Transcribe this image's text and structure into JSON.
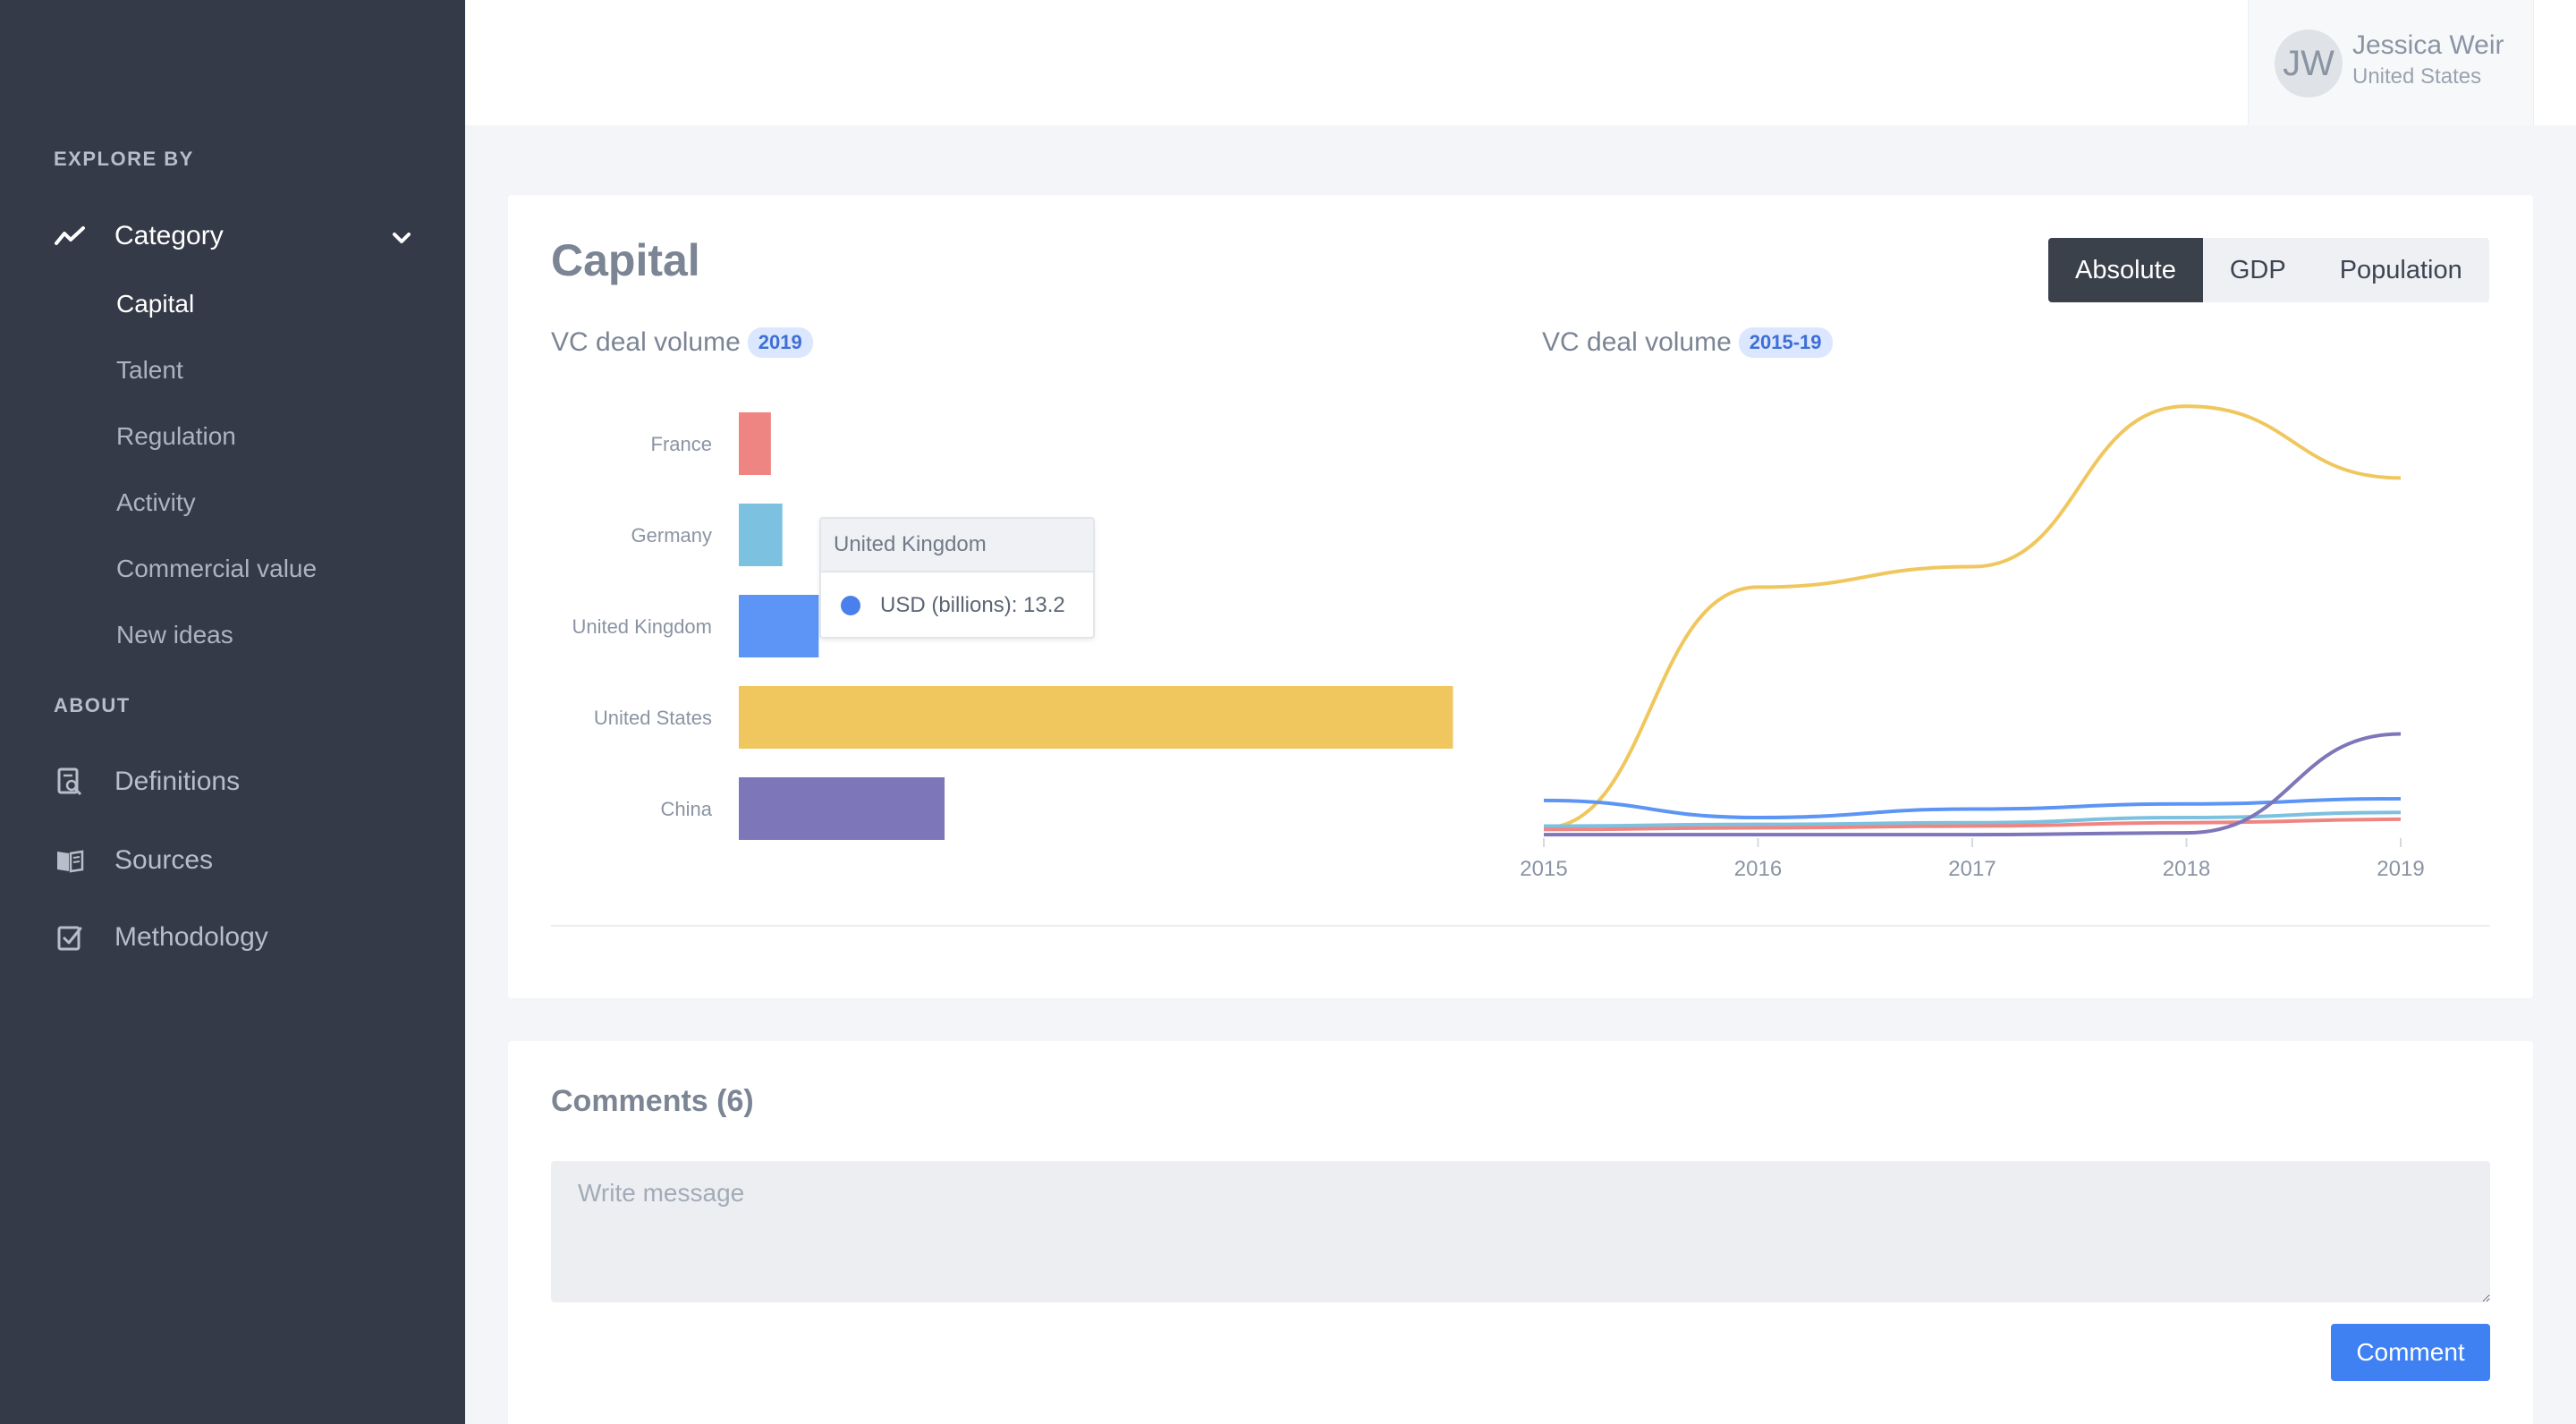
{
  "sidebar": {
    "explore_label": "EXPLORE BY",
    "category": {
      "label": "Category",
      "icon": "trend-line-icon"
    },
    "subitems": [
      "Capital",
      "Talent",
      "Regulation",
      "Activity",
      "Commercial value",
      "New ideas"
    ],
    "active_subitem": "Capital",
    "about_label": "ABOUT",
    "about_items": [
      {
        "label": "Definitions",
        "icon": "document-search-icon"
      },
      {
        "label": "Sources",
        "icon": "book-icon"
      },
      {
        "label": "Methodology",
        "icon": "checklist-icon"
      }
    ]
  },
  "user": {
    "initials": "JW",
    "name": "Jessica Weir",
    "country": "United States"
  },
  "capital": {
    "title": "Capital",
    "toggle": [
      "Absolute",
      "GDP",
      "Population"
    ],
    "toggle_active": "Absolute",
    "left_chart": {
      "title": "VC deal volume",
      "badge": "2019"
    },
    "right_chart": {
      "title": "VC deal volume",
      "badge": "2015-19"
    },
    "tooltip": {
      "title": "United Kingdom",
      "text": "USD (billions): 13.2"
    }
  },
  "comments": {
    "title": "Comments (6)",
    "placeholder": "Write message",
    "button": "Comment"
  },
  "chart_data": [
    {
      "type": "bar",
      "orientation": "horizontal",
      "title": "VC deal volume",
      "categories": [
        "France",
        "Germany",
        "United Kingdom",
        "United States",
        "China"
      ],
      "values": [
        5.3,
        7.2,
        13.2,
        118.0,
        34.0
      ],
      "unit": "USD (billions)",
      "colors": [
        "#ef8582",
        "#7cc1df",
        "#5c95f6",
        "#f0c75e",
        "#7d76b8"
      ],
      "xlim": [
        0,
        120
      ]
    },
    {
      "type": "line",
      "title": "VC deal volume",
      "x": [
        "2015",
        "2016",
        "2017",
        "2018",
        "2019"
      ],
      "ylim": [
        0,
        125
      ],
      "series": [
        {
          "color": "#f0c75e",
          "values": [
            2.5,
            73,
            79,
            126,
            105
          ]
        },
        {
          "color": "#5c95f6",
          "values": [
            10.5,
            5.5,
            8.0,
            9.5,
            11.0
          ]
        },
        {
          "color": "#7cc1df",
          "values": [
            3.0,
            3.5,
            4.0,
            5.5,
            7.0
          ]
        },
        {
          "color": "#ef8582",
          "values": [
            2.0,
            2.5,
            3.0,
            4.0,
            5.0
          ]
        },
        {
          "color": "#7d76b8",
          "values": [
            0.5,
            0.5,
            0.5,
            1.0,
            30.0
          ]
        }
      ]
    }
  ]
}
